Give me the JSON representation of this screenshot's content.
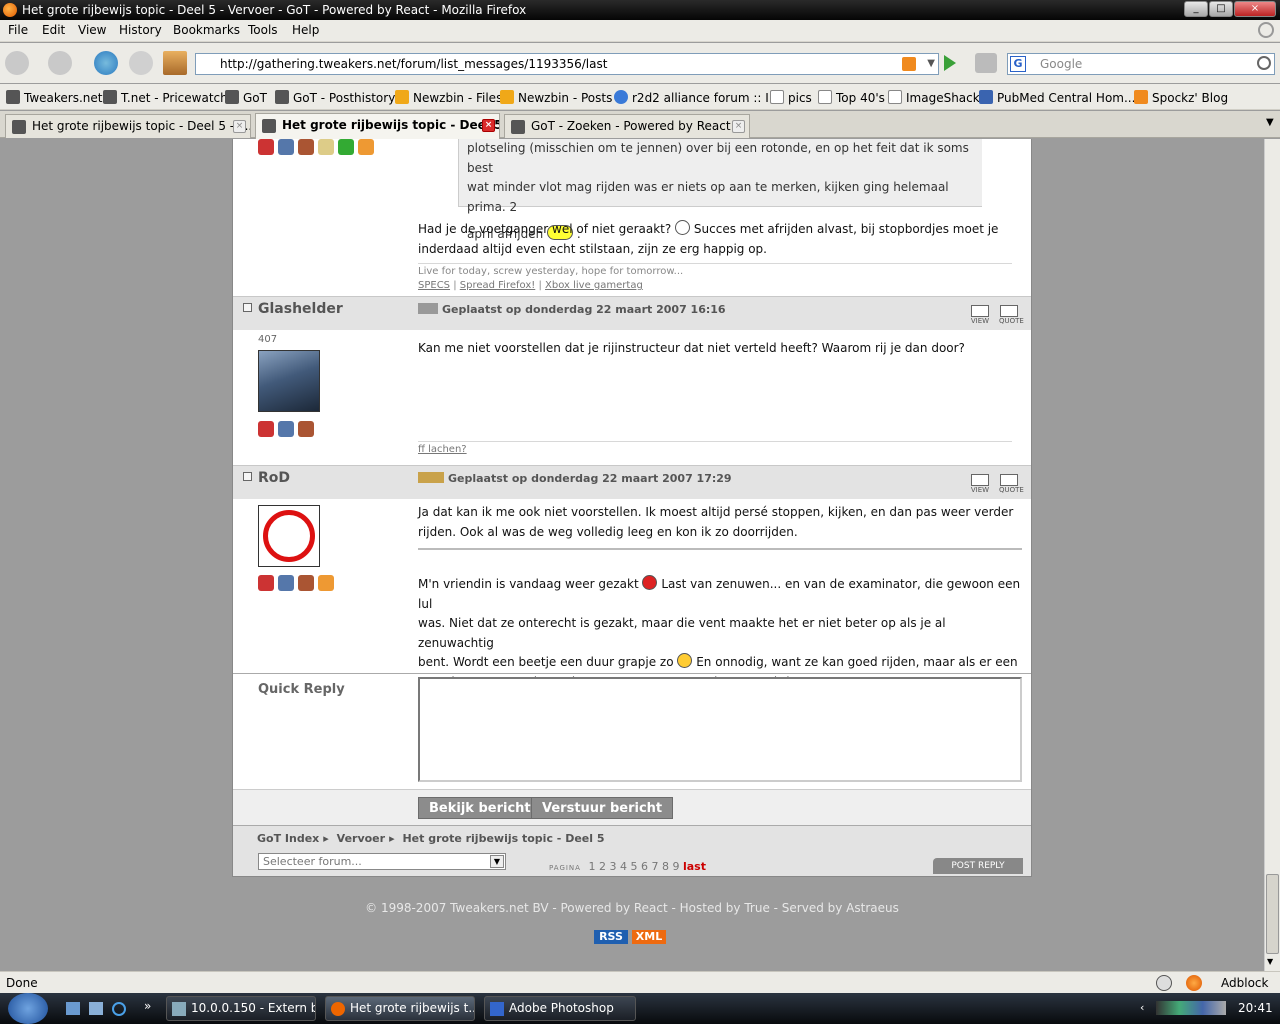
{
  "window": {
    "title": "Het grote rijbewijs topic - Deel 5 - Vervoer - GoT - Powered by React - Mozilla Firefox"
  },
  "menu": [
    "File",
    "Edit",
    "View",
    "History",
    "Bookmarks",
    "Tools",
    "Help"
  ],
  "nav": {
    "url": "http://gathering.tweakers.net/forum/list_messages/1193356/last",
    "search_placeholder": "Google"
  },
  "bookmarks": [
    "Tweakers.net",
    "T.net - Pricewatch",
    "GoT",
    "GoT - Posthistory",
    "Newzbin - Files",
    "Newzbin - Posts",
    "r2d2 alliance forum :: I...",
    "pics",
    "Top 40's",
    "ImageShack",
    "PubMed Central Hom...",
    "Spockz' Blog"
  ],
  "tabs": [
    "Het grote rijbewijs topic - Deel 5 - V...",
    "Het grote rijbewijs topic - Deel 5 ...",
    "GoT - Zoeken - Powered by React"
  ],
  "post0": {
    "quote_lines": [
      "plotseling (misschien om te jennen) over bij een rotonde, en op het feit dat ik soms best",
      "wat minder vlot mag rijden was er niets op aan te merken, kijken ging helemaal prima. 2",
      "april afrijden",
      "."
    ],
    "text_a": "Had je de voetganger wel of niet geraakt?",
    "text_b": "Succes met afrijden alvast, bij stopbordjes moet je",
    "text_c": "inderdaad altijd even echt stilstaan, zijn ze erg happig op.",
    "sig_line": "Live for today, screw yesterday, hope for tomorrow...",
    "sig_links": [
      "SPECS",
      "Spread Firefox!",
      "Xbox live gamertag"
    ]
  },
  "post1": {
    "author": "Glashelder",
    "date": "Geplaatst op donderdag 22 maart 2007 16:16",
    "count": "407",
    "text": "Kan me niet voorstellen dat je rijinstructeur dat niet verteld heeft? Waarom rij je dan door?",
    "sig": "ff lachen?"
  },
  "post2": {
    "author": "RoD",
    "date": "Geplaatst op donderdag 22 maart 2007 17:29",
    "p1_l1": "Ja dat kan ik me ook niet voorstellen. Ik moest altijd persé stoppen, kijken, en dan pas weer verder",
    "p1_l2": "rijden. Ook al was de weg volledig leeg en kon ik zo doorrijden.",
    "p2_l1a": "M'n vriendin is vandaag weer gezakt",
    "p2_l1b": "Last van zenuwen... en van de examinator, die gewoon een lul",
    "p2_l2": "was. Niet dat ze onterecht is gezakt, maar die vent maakte het er niet beter op als je al zenuwachtig",
    "p2_l3a": "bent. Wordt een beetje een duur grapje zo",
    "p2_l3b": "En onnodig, want ze kan goed rijden, maar als er een",
    "p2_l4": "examinator naast zit wordt ze gewoon ontzettend zenuwachtig."
  },
  "post_icons": {
    "view": "VIEW",
    "quote": "QUOTE"
  },
  "quick_reply": {
    "label": "Quick Reply",
    "preview": "Bekijk bericht",
    "send": "Verstuur bericht"
  },
  "footer": {
    "crumbs": [
      "GoT Index",
      "Vervoer",
      "Het grote rijbewijs topic - Deel 5"
    ],
    "select": "Selecteer forum...",
    "pagina": "PAGINA",
    "pages": [
      "1",
      "2",
      "3",
      "4",
      "5",
      "6",
      "7",
      "8",
      "9"
    ],
    "last": "last",
    "post_reply": "POST REPLY",
    "copyright": "© 1998-2007 Tweakers.net BV - Powered by React - Hosted by True - Served by Astraeus",
    "rss": "RSS",
    "xml": "XML"
  },
  "status": {
    "text": "Done",
    "adblock": "Adblock"
  },
  "taskbar": {
    "items": [
      "10.0.0.150 - Extern b...",
      "Het grote rijbewijs t...",
      "Adobe Photoshop"
    ],
    "clock": "20:41"
  },
  "colors": {
    "accent_red": "#cc0000",
    "rss": "#1f5fb0",
    "xml": "#ee6a10"
  }
}
